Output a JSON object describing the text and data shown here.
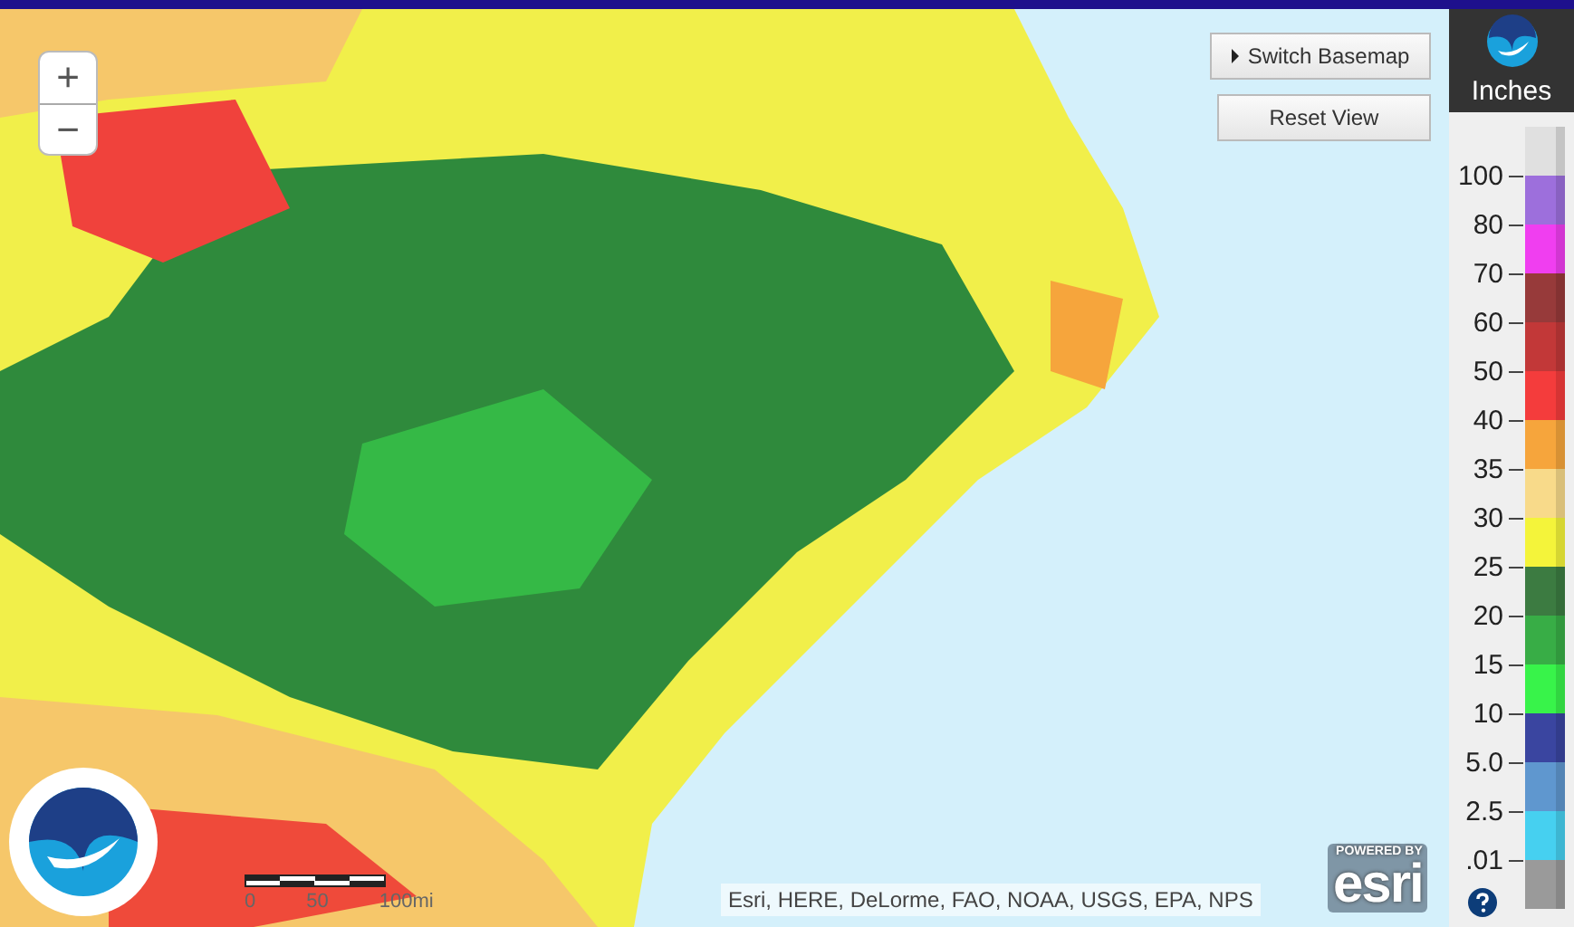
{
  "zoom_controls": [
    {
      "label": "+"
    },
    {
      "label": "−"
    }
  ],
  "map_buttons": [
    {
      "label": "Switch Basemap",
      "kind": "menu"
    },
    {
      "label": "Reset View",
      "kind": "plain"
    }
  ],
  "legend": {
    "unit": "Inches",
    "swatches": [
      {
        "color": "#e0e0e0"
      },
      {
        "color": "#9d6fdc"
      },
      {
        "color": "#f03ef0"
      },
      {
        "color": "#973a3a"
      },
      {
        "color": "#c23838"
      },
      {
        "color": "#f43c3c"
      },
      {
        "color": "#f6a53c"
      },
      {
        "color": "#f8da8a"
      },
      {
        "color": "#f4f43a"
      },
      {
        "color": "#3c7b41"
      },
      {
        "color": "#38ad46"
      },
      {
        "color": "#38f34a"
      },
      {
        "color": "#3a45a0"
      },
      {
        "color": "#5f97cf"
      },
      {
        "color": "#46d0f0"
      },
      {
        "color": "#9a9a9a"
      }
    ],
    "labels": [
      "100",
      "80",
      "70",
      "60",
      "50",
      "40",
      "35",
      "30",
      "25",
      "20",
      "15",
      "10",
      "5.0",
      "2.5",
      ".01"
    ]
  },
  "scale_bar": {
    "labels": [
      "0",
      "50",
      "100mi"
    ]
  },
  "attribution": "Esri, HERE, DeLorme, FAO, NOAA, USGS, EPA, NPS",
  "powered_by": {
    "caption": "POWERED BY",
    "brand": "esri"
  }
}
